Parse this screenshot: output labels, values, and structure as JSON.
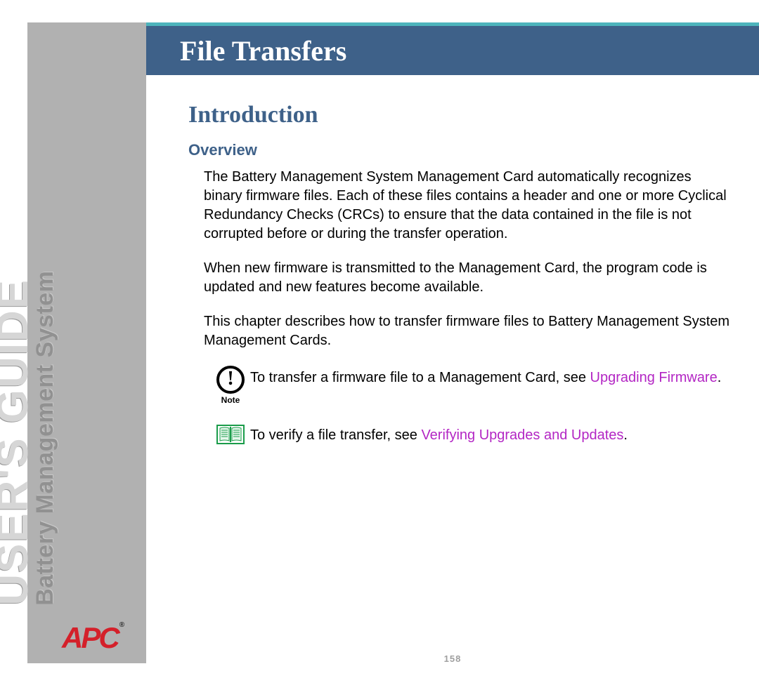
{
  "sidebar": {
    "guide_label": "USER'S GUIDE",
    "system_label": "Battery Management System",
    "logo_text": "APC",
    "logo_reg": "®"
  },
  "header": {
    "chapter_title": "File Transfers"
  },
  "section": {
    "h2": "Introduction",
    "h3": "Overview",
    "p1": "The Battery Management System Management Card automatically recognizes binary firmware files. Each of these files contains a header and one or more Cyclical Redundancy Checks (CRCs) to ensure that the data contained in the file is not corrupted before or during the transfer operation.",
    "p2": "When new firmware is transmitted to the Management Card, the program code is updated and new features become available.",
    "p3": "This chapter describes how to transfer firmware files to Battery Management System Management Cards."
  },
  "note": {
    "label": "Note",
    "text_pre": "To transfer a firmware file to a Management Card, see ",
    "link": "Upgrading Firmware",
    "text_post": "."
  },
  "ref": {
    "text_pre": "To verify a file transfer, see ",
    "link": "Verifying Upgrades and Updates",
    "text_post": "."
  },
  "page_number": "158"
}
